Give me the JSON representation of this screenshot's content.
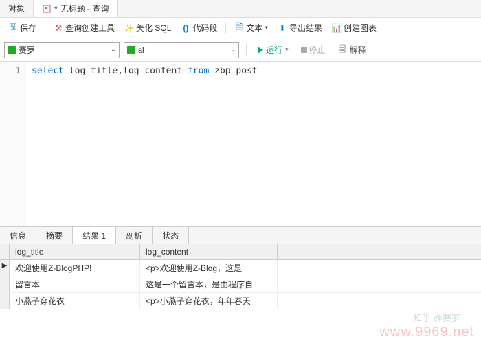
{
  "top_tabs": {
    "object": "对象",
    "query": "无标题 - 查询",
    "dirty_marker": "*"
  },
  "toolbar": {
    "save": "保存",
    "query_builder": "查询创建工具",
    "beautify": "美化 SQL",
    "snippet": "代码段",
    "text": "文本",
    "export": "导出结果",
    "chart": "创建图表"
  },
  "selectors": {
    "db": "赛罗",
    "schema": "sl",
    "run": "运行",
    "stop": "停止",
    "explain": "解释"
  },
  "editor": {
    "line_no": "1",
    "kw1": "select",
    "cols": " log_title,log_content ",
    "kw2": "from",
    "table": " zbp_post"
  },
  "result_tabs": {
    "info": "信息",
    "summary": "摘要",
    "result1": "结果 1",
    "profile": "剖析",
    "status": "状态"
  },
  "grid": {
    "headers": {
      "c1": "log_title",
      "c2": "log_content"
    },
    "rows": [
      {
        "c1": "欢迎使用Z-BlogPHP!",
        "c2": "<p>欢迎使用Z-Blog，这是"
      },
      {
        "c1": "留言本",
        "c2": "这是一个留言本，是由程序自"
      },
      {
        "c1": "小燕子穿花衣",
        "c2": "<p>小燕子穿花衣，年年春天"
      }
    ]
  },
  "watermark": {
    "main": "www.9969.net",
    "sub": "知乎 @赛罗"
  }
}
